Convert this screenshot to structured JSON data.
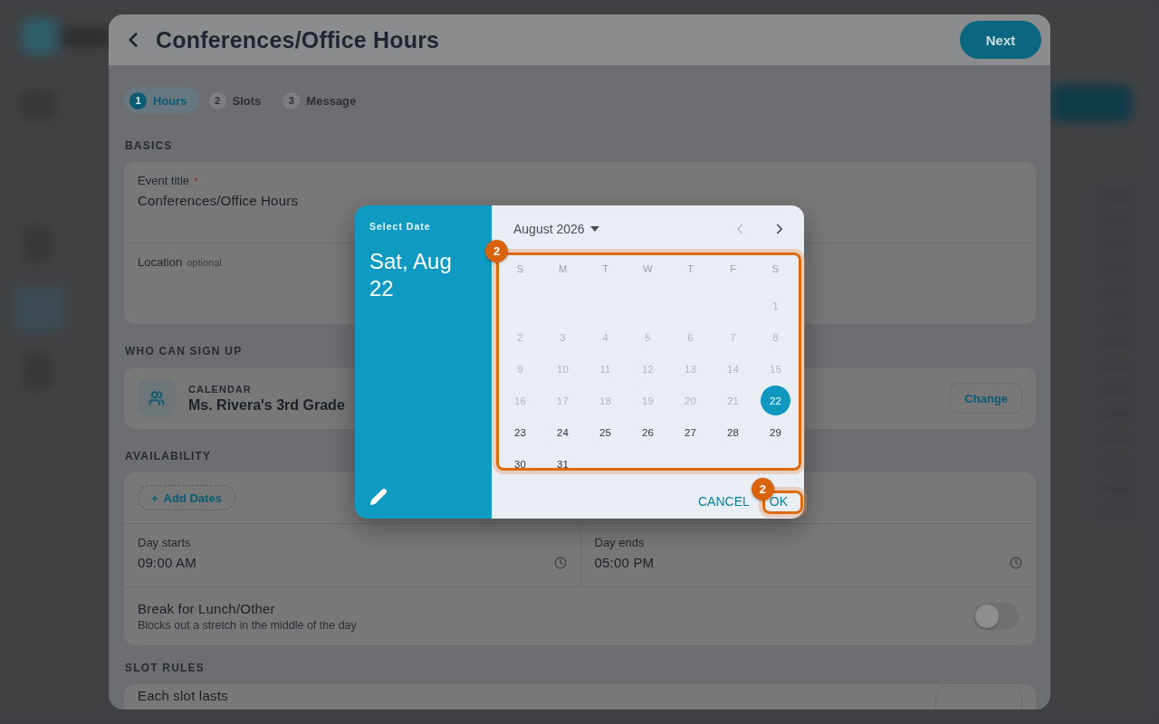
{
  "sheet": {
    "title": "Conferences/Office Hours",
    "next_button": "Next"
  },
  "steps": [
    {
      "number": "1",
      "label": "Hours",
      "selected": true
    },
    {
      "number": "2",
      "label": "Slots",
      "selected": false
    },
    {
      "number": "3",
      "label": "Message",
      "selected": false
    }
  ],
  "basics": {
    "heading": "BASICS",
    "event_title": {
      "label": "Event title",
      "required": true,
      "required_mark": "*",
      "value": "Conferences/Office Hours"
    },
    "location": {
      "label": "Location",
      "hint": "optional"
    }
  },
  "who_can_sign_up": {
    "heading": "WHO CAN SIGN UP",
    "caption": "CALENDAR",
    "name": "Ms. Rivera's 3rd Grade",
    "button": "Change"
  },
  "availability": {
    "heading": "AVAILABILITY",
    "add_dates": "Add Dates",
    "add_icon": "+",
    "day_starts": {
      "label": "Day starts",
      "value": "09:00 AM"
    },
    "day_ends": {
      "label": "Day ends",
      "value": "05:00 PM"
    },
    "break": {
      "label": "Break for Lunch/Other",
      "description": "Blocks out a stretch in the middle of the day",
      "on": false
    }
  },
  "slot_rules": {
    "heading": "SLOT RULES",
    "each_slot_label": "Each slot lasts"
  },
  "date_dialog": {
    "caption": "Select Date",
    "selected_date": "Sat, Aug 22",
    "month": "August 2026",
    "prev_disabled": true,
    "calendar": {
      "annotation": "2",
      "weekdays": [
        "S",
        "M",
        "T",
        "W",
        "T",
        "F",
        "S"
      ],
      "weeks": [
        {
          "days": [
            {
              "day": "1",
              "disabled": true,
              "selected": false
            }
          ]
        },
        {
          "days": [
            {
              "day": "2",
              "disabled": true,
              "selected": false
            },
            {
              "day": "3",
              "disabled": true,
              "selected": false
            },
            {
              "day": "4",
              "disabled": true,
              "selected": false
            },
            {
              "day": "5",
              "disabled": true,
              "selected": false
            },
            {
              "day": "6",
              "disabled": true,
              "selected": false
            },
            {
              "day": "7",
              "disabled": true,
              "selected": false
            },
            {
              "day": "8",
              "disabled": true,
              "selected": false
            }
          ]
        },
        {
          "days": [
            {
              "day": "9",
              "disabled": true,
              "selected": false
            },
            {
              "day": "10",
              "disabled": true,
              "selected": false
            },
            {
              "day": "11",
              "disabled": true,
              "selected": false
            },
            {
              "day": "12",
              "disabled": true,
              "selected": false
            },
            {
              "day": "13",
              "disabled": true,
              "selected": false
            },
            {
              "day": "14",
              "disabled": true,
              "selected": false
            },
            {
              "day": "15",
              "disabled": true,
              "selected": false
            }
          ]
        },
        {
          "days": [
            {
              "day": "16",
              "disabled": true,
              "selected": false
            },
            {
              "day": "17",
              "disabled": true,
              "selected": false
            },
            {
              "day": "18",
              "disabled": true,
              "selected": false
            },
            {
              "day": "19",
              "disabled": true,
              "selected": false
            },
            {
              "day": "20",
              "disabled": true,
              "selected": false
            },
            {
              "day": "21",
              "disabled": true,
              "selected": false
            },
            {
              "day": "22",
              "disabled": false,
              "selected": true
            }
          ]
        },
        {
          "days": [
            {
              "day": "23",
              "disabled": false,
              "selected": false
            },
            {
              "day": "24",
              "disabled": false,
              "selected": false
            },
            {
              "day": "25",
              "disabled": false,
              "selected": false
            },
            {
              "day": "26",
              "disabled": false,
              "selected": false
            },
            {
              "day": "27",
              "disabled": false,
              "selected": false
            },
            {
              "day": "28",
              "disabled": false,
              "selected": false
            },
            {
              "day": "29",
              "disabled": false,
              "selected": false
            }
          ]
        },
        {
          "days": [
            {
              "day": "30",
              "disabled": false,
              "selected": false
            },
            {
              "day": "31",
              "disabled": false,
              "selected": false
            }
          ]
        }
      ]
    },
    "cancel_button": {
      "label": "CANCEL"
    },
    "ok_button": {
      "label": "OK",
      "annotation": "2"
    }
  }
}
